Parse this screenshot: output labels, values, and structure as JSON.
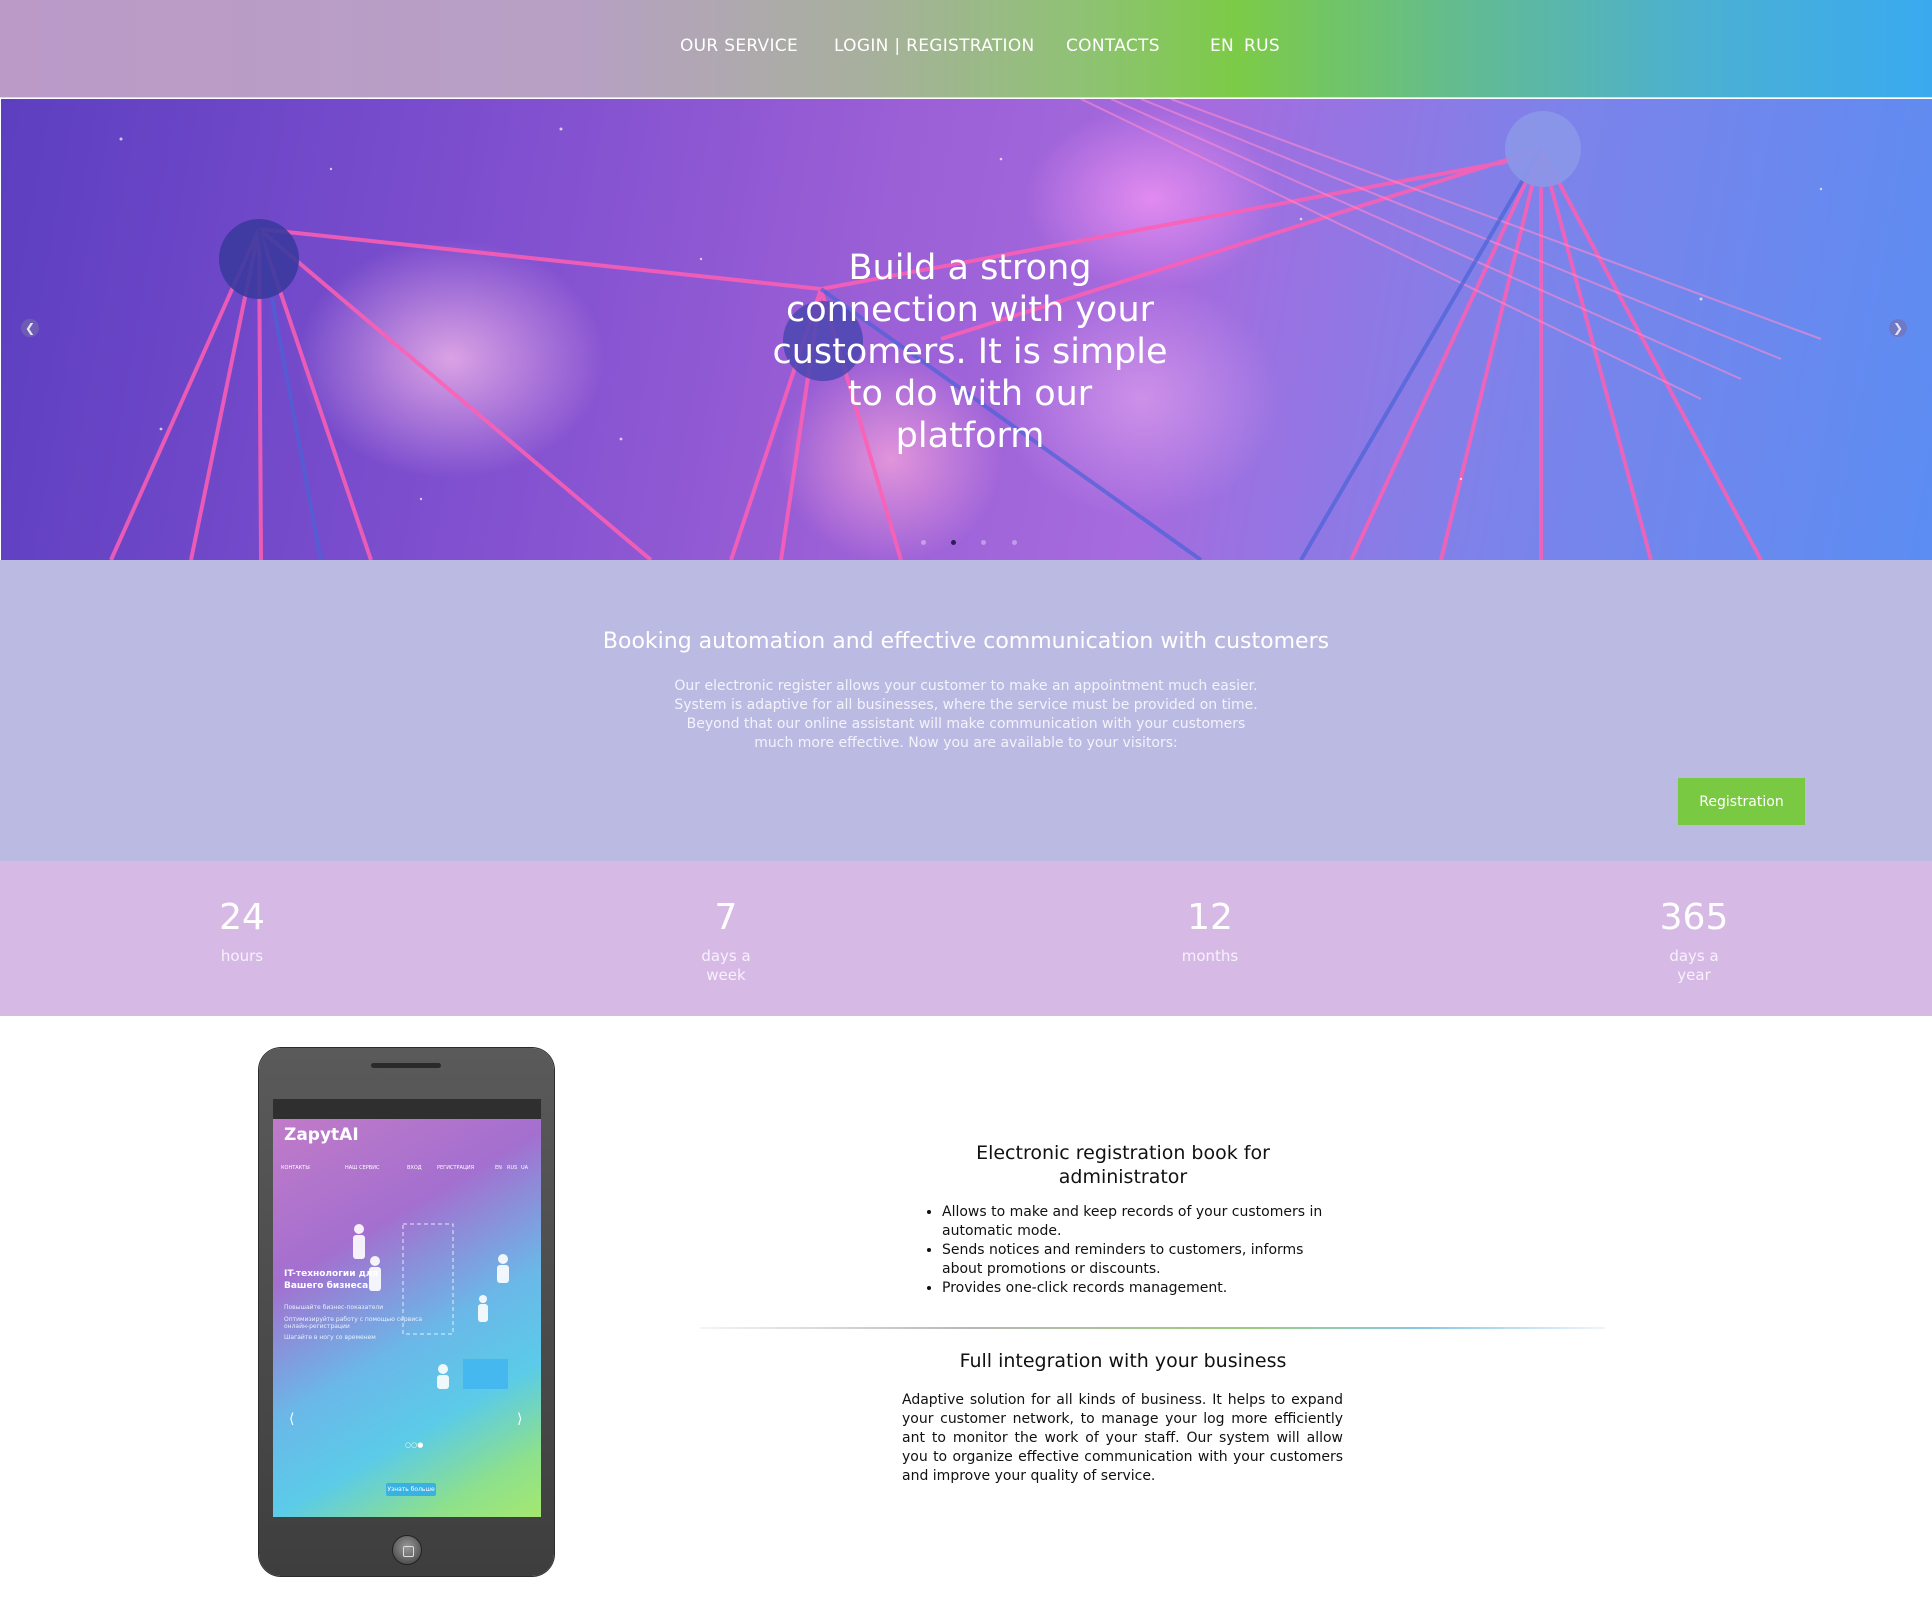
{
  "header": {
    "nav": [
      "OUR SERVICE",
      "LOGIN | REGISTRATION",
      "CONTACTS"
    ],
    "languages": [
      "EN",
      "RUS"
    ]
  },
  "hero": {
    "title": "Build a strong connection with your customers. It is simple to do with our platform",
    "prev_icon": "chevron-left-icon",
    "next_icon": "chevron-right-icon",
    "slides_count": 4,
    "active_slide": 2
  },
  "intro": {
    "title": "Booking automation and effective communication with customers",
    "text_lines": [
      "Our electronic register allows your customer to make an appointment much easier.",
      "System is adaptive for all businesses, where the service must be provided on time.",
      "Beyond that our online assistant will make communication with your customers",
      "much more effective. Now you are available to your visitors:"
    ],
    "button": "Registration"
  },
  "stats": [
    {
      "number": "24",
      "label": "hours"
    },
    {
      "number": "7",
      "label": "days a week"
    },
    {
      "number": "12",
      "label": "months"
    },
    {
      "number": "365",
      "label": "days a year"
    }
  ],
  "phone_screen": {
    "brand": "ZapytAI",
    "nav": [
      "КОНТАКТЫ",
      "НАШ СЕРВИС",
      "ВХОД",
      "РЕГИСТРАЦИЯ",
      "EN",
      "RUS",
      "UA"
    ],
    "heading": "IT-технологии для Вашего бизнеса",
    "lines": [
      "Повышайте бизнес-показатели",
      "Оптимизируйте работу с помощью сервиса онлайн-регистрации",
      "Шагайте в ногу со временем"
    ],
    "button": "Узнать больше"
  },
  "features": {
    "book_title": "Electronic registration book for administrator",
    "book_items": [
      "Allows to make and keep records of your customers in automatic mode.",
      "Sends notices and reminders to customers, informs about promotions or discounts.",
      "Provides one-click records management."
    ],
    "integration_title": "Full integration with your business",
    "integration_text": "Adaptive solution for all kinds of business. It helps to expand your customer network, to manage your log more efficiently ant to monitor the work of your staff. Our system will allow you to organize effective communication with your customers and improve your quality of service."
  },
  "colors": {
    "accent_green": "#7ac943",
    "intro_bg": "#bbbae2",
    "stats_bg": "#d6bae5"
  }
}
